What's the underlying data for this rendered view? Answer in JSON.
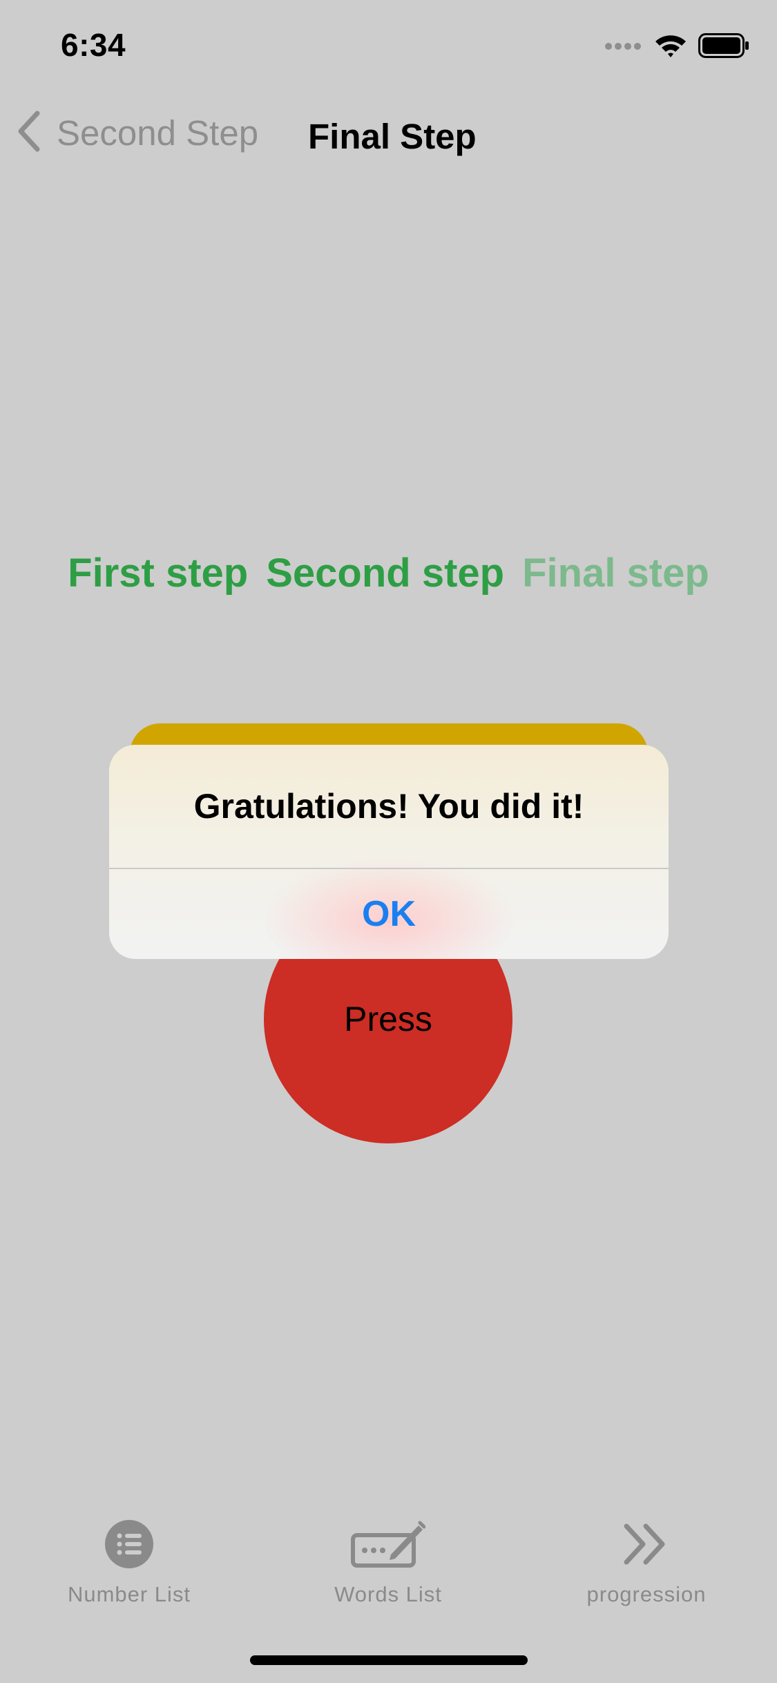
{
  "status_bar": {
    "time": "6:34",
    "icons": [
      "signal-icon",
      "wifi-icon",
      "battery-icon"
    ]
  },
  "nav": {
    "back_label": "Second Step",
    "title": "Final Step"
  },
  "steps": [
    {
      "label": "First step",
      "state": "done"
    },
    {
      "label": "Second step",
      "state": "done"
    },
    {
      "label": "Final step",
      "state": "current"
    }
  ],
  "press_button": {
    "label": "Press"
  },
  "alert": {
    "message": "Gratulations! You did it!",
    "ok_label": "OK"
  },
  "tab_bar": {
    "items": [
      {
        "label": "Number List",
        "icon": "list-icon"
      },
      {
        "label": "Words List",
        "icon": "keyboard-pencil-icon"
      },
      {
        "label": "progression",
        "icon": "double-chevron-icon"
      }
    ]
  },
  "colors": {
    "background": "#cdcdcd",
    "step_done": "#2e9e45",
    "step_current": "#7cb98c",
    "press_button": "#cc2d24",
    "yellow_card": "#d1a500",
    "alert_action": "#1a7ff0",
    "tab_inactive": "#8a8a8a"
  }
}
